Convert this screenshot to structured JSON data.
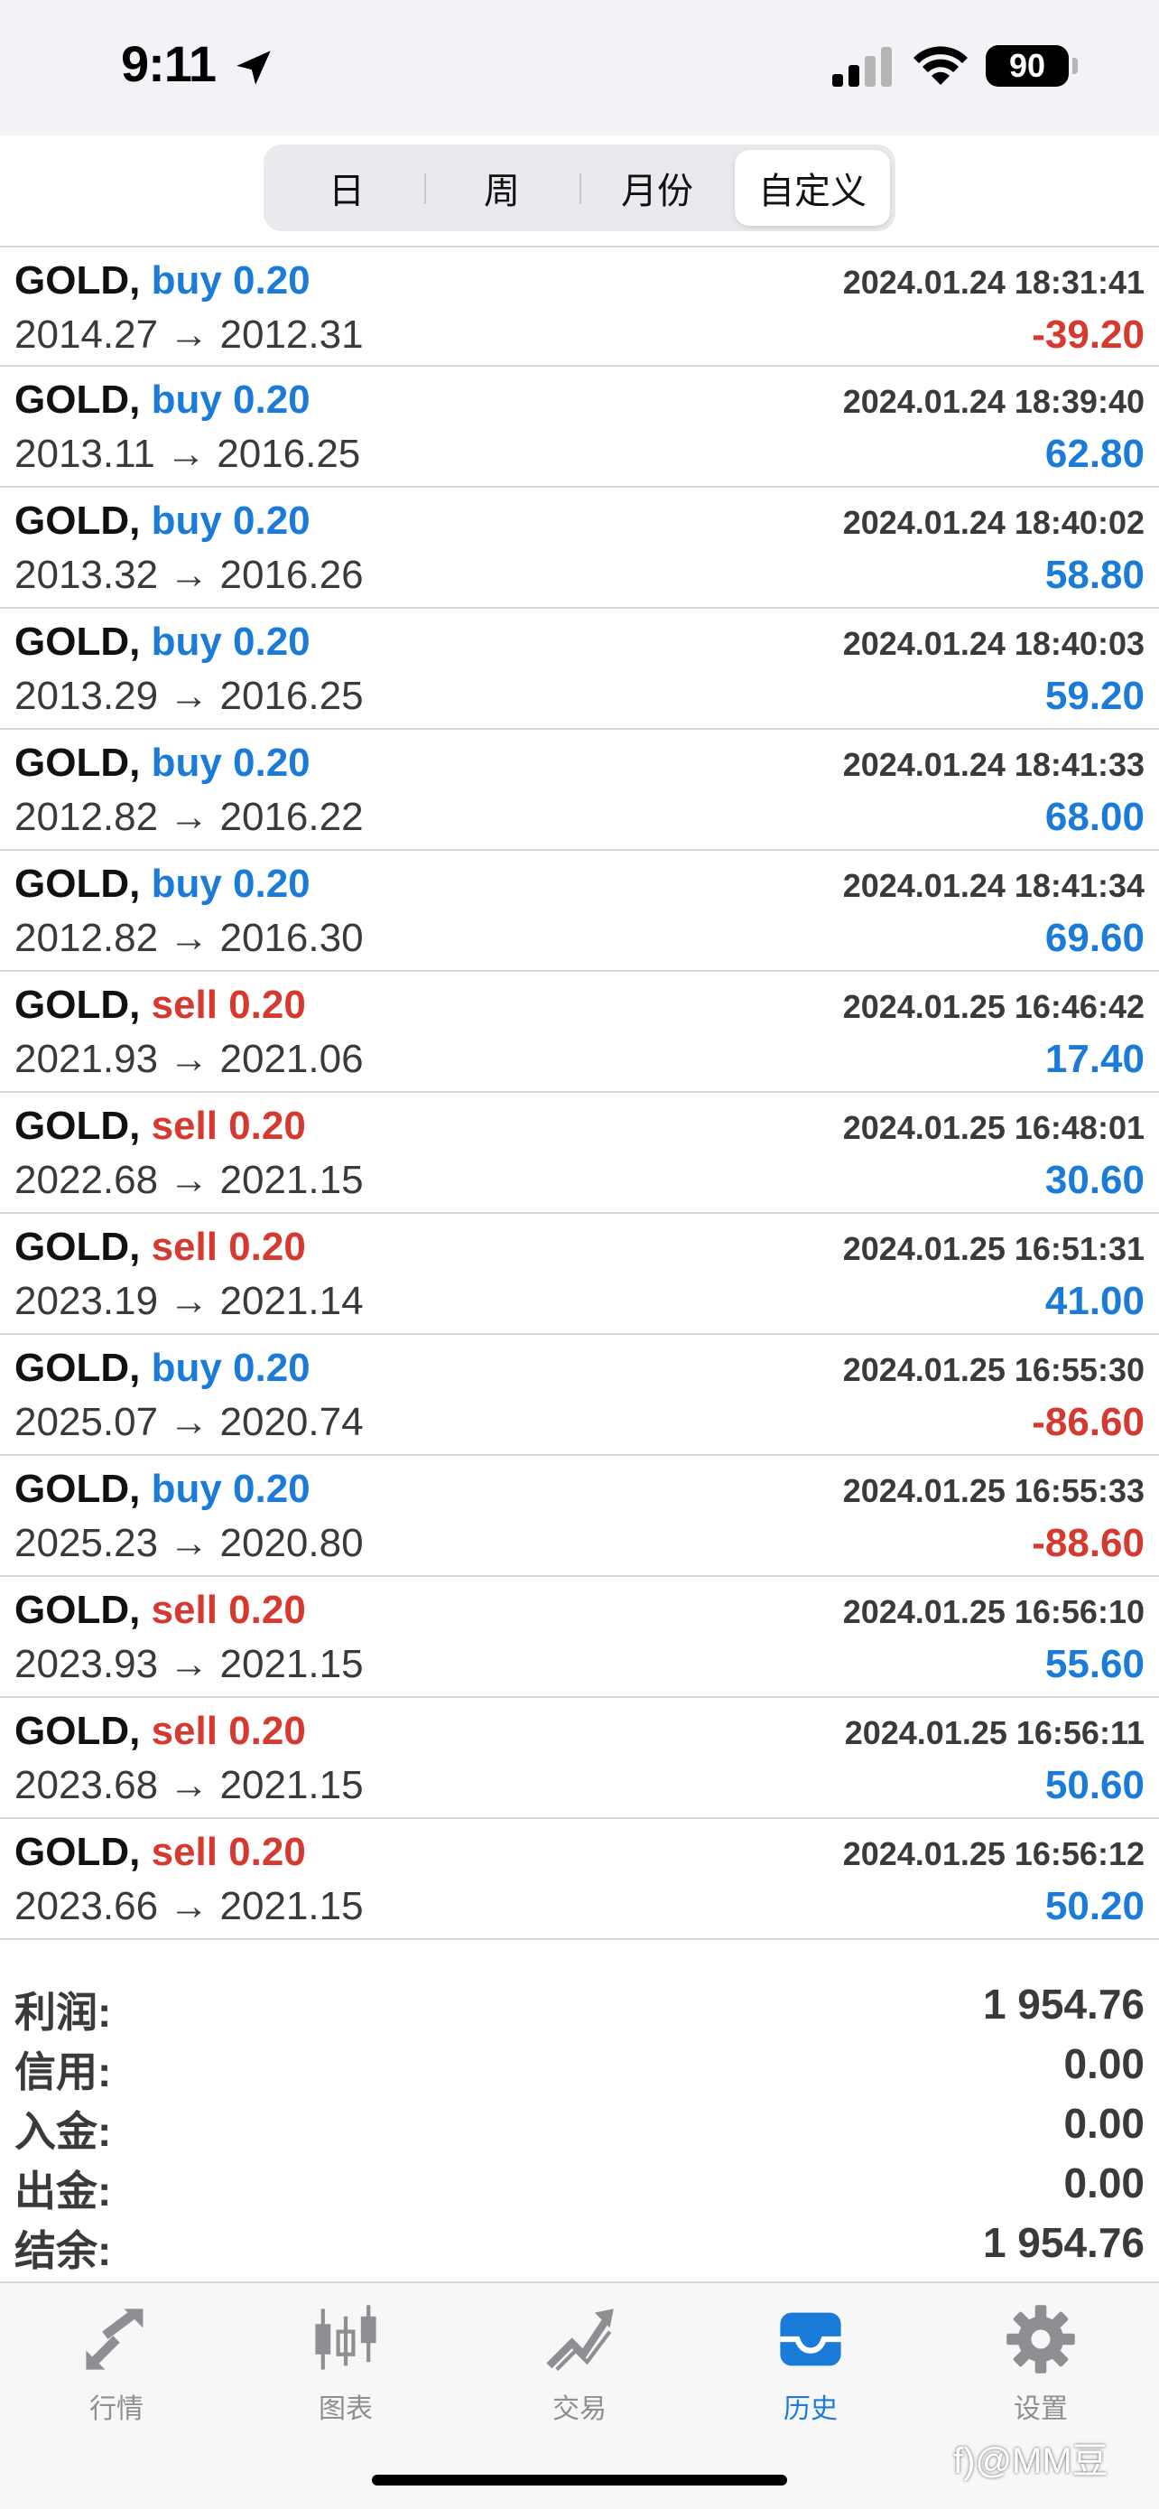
{
  "status_bar": {
    "time": "9:11",
    "battery": "90"
  },
  "segments": [
    {
      "label": "日",
      "active": false
    },
    {
      "label": "周",
      "active": false
    },
    {
      "label": "月份",
      "active": false
    },
    {
      "label": "自定义",
      "active": true
    }
  ],
  "trades": [
    {
      "symbol": "GOLD,",
      "side_label": "buy 0.20",
      "side": "buy",
      "datetime": "2024.01.24 18:31:41",
      "prices": "2014.27 → 2012.31",
      "profit": "-39.20"
    },
    {
      "symbol": "GOLD,",
      "side_label": "buy 0.20",
      "side": "buy",
      "datetime": "2024.01.24 18:39:40",
      "prices": "2013.11 → 2016.25",
      "profit": "62.80"
    },
    {
      "symbol": "GOLD,",
      "side_label": "buy 0.20",
      "side": "buy",
      "datetime": "2024.01.24 18:40:02",
      "prices": "2013.32 → 2016.26",
      "profit": "58.80"
    },
    {
      "symbol": "GOLD,",
      "side_label": "buy 0.20",
      "side": "buy",
      "datetime": "2024.01.24 18:40:03",
      "prices": "2013.29 → 2016.25",
      "profit": "59.20"
    },
    {
      "symbol": "GOLD,",
      "side_label": "buy 0.20",
      "side": "buy",
      "datetime": "2024.01.24 18:41:33",
      "prices": "2012.82 → 2016.22",
      "profit": "68.00"
    },
    {
      "symbol": "GOLD,",
      "side_label": "buy 0.20",
      "side": "buy",
      "datetime": "2024.01.24 18:41:34",
      "prices": "2012.82 → 2016.30",
      "profit": "69.60"
    },
    {
      "symbol": "GOLD,",
      "side_label": "sell 0.20",
      "side": "sell",
      "datetime": "2024.01.25 16:46:42",
      "prices": "2021.93 → 2021.06",
      "profit": "17.40"
    },
    {
      "symbol": "GOLD,",
      "side_label": "sell 0.20",
      "side": "sell",
      "datetime": "2024.01.25 16:48:01",
      "prices": "2022.68 → 2021.15",
      "profit": "30.60"
    },
    {
      "symbol": "GOLD,",
      "side_label": "sell 0.20",
      "side": "sell",
      "datetime": "2024.01.25 16:51:31",
      "prices": "2023.19 → 2021.14",
      "profit": "41.00"
    },
    {
      "symbol": "GOLD,",
      "side_label": "buy 0.20",
      "side": "buy",
      "datetime": "2024.01.25 16:55:30",
      "prices": "2025.07 → 2020.74",
      "profit": "-86.60"
    },
    {
      "symbol": "GOLD,",
      "side_label": "buy 0.20",
      "side": "buy",
      "datetime": "2024.01.25 16:55:33",
      "prices": "2025.23 → 2020.80",
      "profit": "-88.60"
    },
    {
      "symbol": "GOLD,",
      "side_label": "sell 0.20",
      "side": "sell",
      "datetime": "2024.01.25 16:56:10",
      "prices": "2023.93 → 2021.15",
      "profit": "55.60"
    },
    {
      "symbol": "GOLD,",
      "side_label": "sell 0.20",
      "side": "sell",
      "datetime": "2024.01.25 16:56:11",
      "prices": "2023.68 → 2021.15",
      "profit": "50.60"
    },
    {
      "symbol": "GOLD,",
      "side_label": "sell 0.20",
      "side": "sell",
      "datetime": "2024.01.25 16:56:12",
      "prices": "2023.66 → 2021.15",
      "profit": "50.20"
    }
  ],
  "summary": [
    {
      "label": "利润:",
      "value": "1 954.76"
    },
    {
      "label": "信用:",
      "value": "0.00"
    },
    {
      "label": "入金:",
      "value": "0.00"
    },
    {
      "label": "出金:",
      "value": "0.00"
    },
    {
      "label": "结余:",
      "value": "1 954.76"
    }
  ],
  "tabs": [
    {
      "label": "行情",
      "icon": "quotes-arrows-icon",
      "active": false
    },
    {
      "label": "图表",
      "icon": "candlestick-chart-icon",
      "active": false
    },
    {
      "label": "交易",
      "icon": "trade-trend-icon",
      "active": false
    },
    {
      "label": "历史",
      "icon": "history-tray-icon",
      "active": true
    },
    {
      "label": "设置",
      "icon": "gear-icon",
      "active": false
    }
  ],
  "watermark": "f)@MM豆",
  "colors": {
    "buy": "#1a7bd9",
    "sell": "#d6392f",
    "active_tab": "#1a7bd9"
  }
}
